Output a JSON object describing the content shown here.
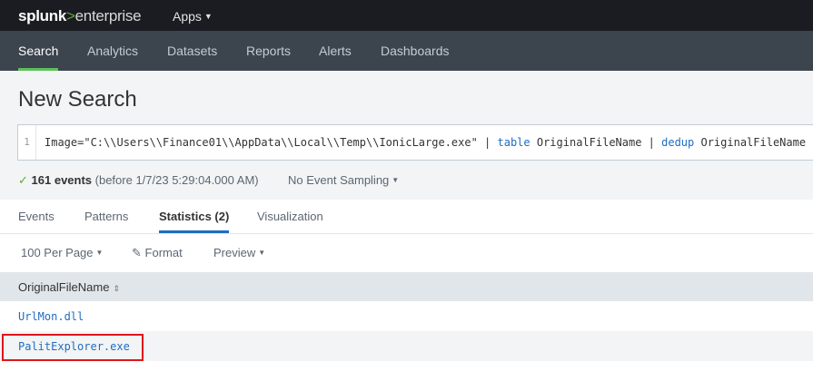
{
  "brand": {
    "part1": "splunk",
    "part2": ">",
    "part3": "enterprise"
  },
  "topnav": {
    "apps_label": "Apps"
  },
  "appnav": {
    "items": [
      {
        "label": "Search",
        "active": true
      },
      {
        "label": "Analytics"
      },
      {
        "label": "Datasets"
      },
      {
        "label": "Reports"
      },
      {
        "label": "Alerts"
      },
      {
        "label": "Dashboards"
      }
    ]
  },
  "page": {
    "title": "New Search"
  },
  "search": {
    "line_number": "1",
    "query_part1": "Image=\"C:\\\\Users\\\\Finance01\\\\AppData\\\\Local\\\\Temp\\\\IonicLarge.exe\" | ",
    "kw1": "table",
    "query_part2": " OriginalFileName | ",
    "kw2": "dedup",
    "query_part3": " OriginalFileName"
  },
  "status": {
    "check": "✓",
    "events": "161 events",
    "before": " (before 1/7/23 5:29:04.000 AM)",
    "sampling": "No Event Sampling"
  },
  "tabs": [
    {
      "label": "Events"
    },
    {
      "label": "Patterns"
    },
    {
      "label": "Statistics (2)",
      "active": true
    },
    {
      "label": "Visualization"
    }
  ],
  "toolbar": {
    "per_page": "100 Per Page",
    "format": "Format",
    "preview": "Preview"
  },
  "table": {
    "column": "OriginalFileName",
    "rows": [
      "UrlMon.dll",
      "PalitExplorer.exe"
    ]
  },
  "colors": {
    "accent_green": "#5cc05c",
    "link_blue": "#1e6dc4",
    "highlight_red": "#e0141c"
  }
}
